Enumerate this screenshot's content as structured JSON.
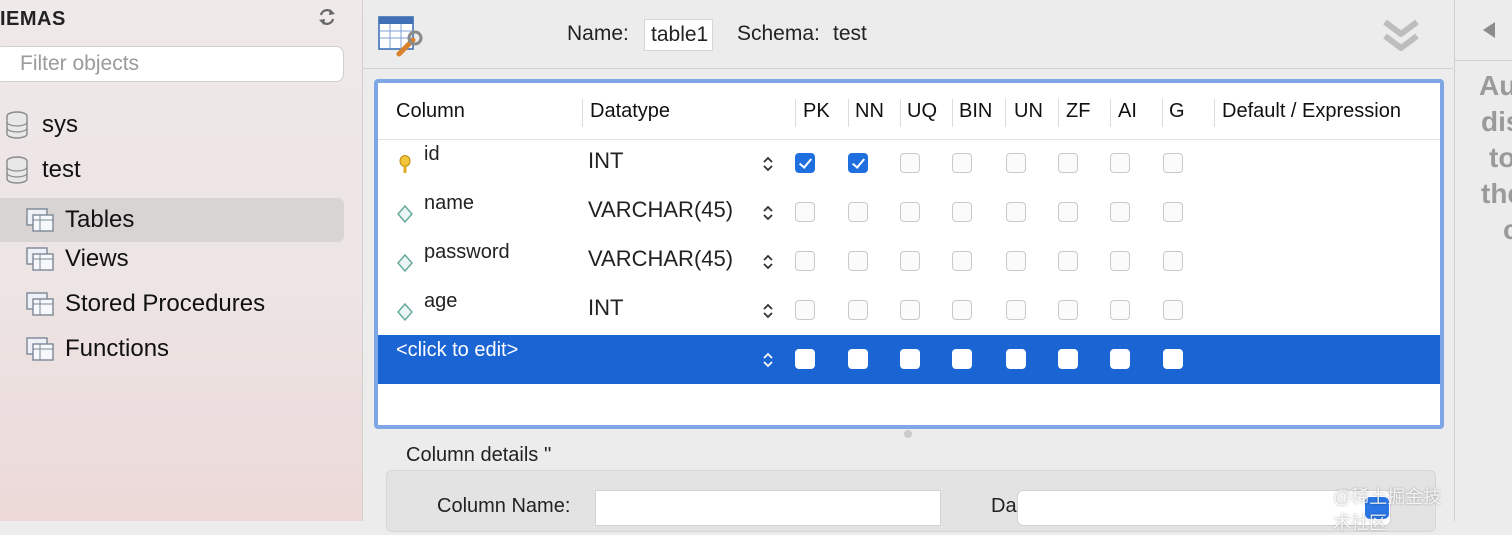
{
  "sidebar": {
    "title": "IEMAS",
    "filter_placeholder": "Filter objects",
    "items": [
      {
        "label": "sys"
      },
      {
        "label": "test"
      },
      {
        "label": "Tables"
      },
      {
        "label": "Views"
      },
      {
        "label": "Stored Procedures"
      },
      {
        "label": "Functions"
      }
    ]
  },
  "editor": {
    "name_label": "Name:",
    "name_value": "table1",
    "schema_label": "Schema:",
    "schema_value": "test",
    "columns_header": [
      "Column",
      "Datatype",
      "PK",
      "NN",
      "UQ",
      "BIN",
      "UN",
      "ZF",
      "AI",
      "G",
      "Default / Expression"
    ],
    "rows": [
      {
        "name": "id",
        "type": "INT",
        "icon": "key-icon",
        "flags": [
          true,
          true,
          false,
          false,
          false,
          false,
          false,
          false
        ]
      },
      {
        "name": "name",
        "type": "VARCHAR(45)",
        "icon": "column-diamond-icon",
        "flags": [
          false,
          false,
          false,
          false,
          false,
          false,
          false,
          false
        ]
      },
      {
        "name": "password",
        "type": "VARCHAR(45)",
        "icon": "column-diamond-icon",
        "flags": [
          false,
          false,
          false,
          false,
          false,
          false,
          false,
          false
        ]
      },
      {
        "name": "age",
        "type": "INT",
        "icon": "column-diamond-icon",
        "flags": [
          false,
          false,
          false,
          false,
          false,
          false,
          false,
          false
        ]
      }
    ],
    "new_row_label": "<click to edit>",
    "details_title": "Column details ''",
    "column_name_label": "Column Name:",
    "column_name_value": "",
    "da_label": "Da"
  },
  "right_panel": {
    "lines": [
      "Au",
      "dis",
      "to",
      "the",
      "c"
    ]
  },
  "watermark": "@稀土掘金技术社区",
  "colors": {
    "selection": "#1a64d4",
    "checkbox_checked": "#1f6fe0",
    "grid_border": "#7fa7e6"
  }
}
